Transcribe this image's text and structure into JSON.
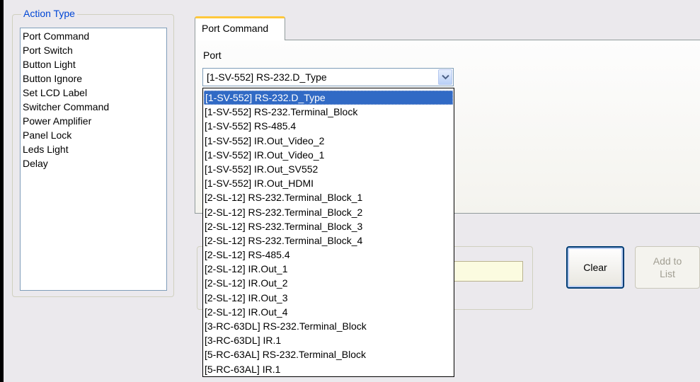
{
  "action_type": {
    "title": "Action Type",
    "items": [
      {
        "label": "Port Command",
        "selected": true
      },
      {
        "label": "Port Switch"
      },
      {
        "label": "Button Light"
      },
      {
        "label": "Button Ignore"
      },
      {
        "label": "Set LCD Label"
      },
      {
        "label": "Switcher Command"
      },
      {
        "label": "Power Amplifier"
      },
      {
        "label": "Panel Lock"
      },
      {
        "label": "Leds Light"
      },
      {
        "label": "Delay"
      }
    ]
  },
  "tab": {
    "label": "Port Command"
  },
  "port": {
    "label": "Port",
    "selected_value": "[1-SV-552] RS-232.D_Type",
    "options": [
      "[1-SV-552] RS-232.D_Type",
      "[1-SV-552] RS-232.Terminal_Block",
      "[1-SV-552] RS-485.4",
      "[1-SV-552] IR.Out_Video_2",
      "[1-SV-552] IR.Out_Video_1",
      "[1-SV-552] IR.Out_SV552",
      "[1-SV-552] IR.Out_HDMI",
      "[2-SL-12] RS-232.Terminal_Block_1",
      "[2-SL-12] RS-232.Terminal_Block_2",
      "[2-SL-12] RS-232.Terminal_Block_3",
      "[2-SL-12] RS-232.Terminal_Block_4",
      "[2-SL-12] RS-485.4",
      "[2-SL-12] IR.Out_1",
      "[2-SL-12] IR.Out_2",
      "[2-SL-12] IR.Out_3",
      "[2-SL-12] IR.Out_4",
      "[3-RC-63DL] RS-232.Terminal_Block",
      "[3-RC-63DL] IR.1",
      "[5-RC-63AL] RS-232.Terminal_Block",
      "[5-RC-63AL] IR.1"
    ]
  },
  "buttons": {
    "clear": "Clear",
    "add_to_list": "Add to\nList"
  },
  "colors": {
    "selection": "#316ac5",
    "group_title": "#0046d5",
    "tab_highlight": "#ffc83c"
  },
  "icons": {
    "combo_arrow": "chevron-down-icon"
  }
}
